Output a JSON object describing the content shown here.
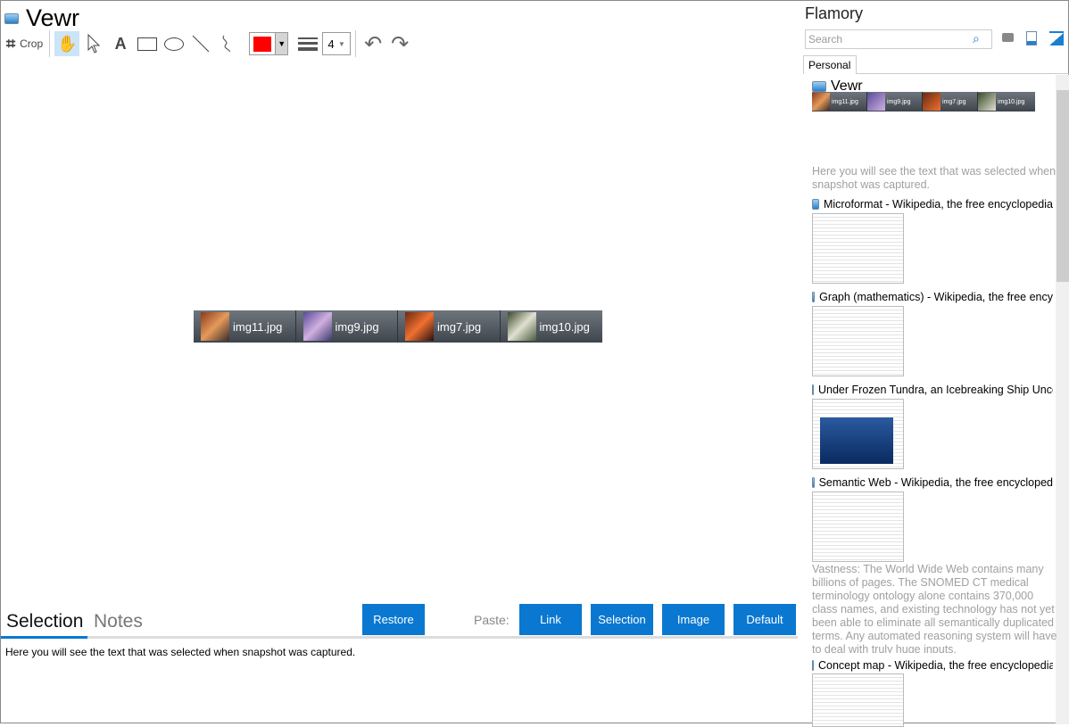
{
  "app": {
    "title": "Vewr"
  },
  "toolbar": {
    "crop": "Crop",
    "width_value": "4",
    "color": "#ff0000"
  },
  "strip": [
    {
      "name": "img11.jpg"
    },
    {
      "name": "img9.jpg"
    },
    {
      "name": "img7.jpg"
    },
    {
      "name": "img10.jpg"
    }
  ],
  "bottom": {
    "tabs": [
      "Selection",
      "Notes"
    ],
    "restore": "Restore",
    "paste_label": "Paste:",
    "paste_buttons": [
      "Link",
      "Selection",
      "Image",
      "Default"
    ],
    "selection_text": "Here you will see the text that was selected when snapshot was captured."
  },
  "sidebar": {
    "title": "Flamory",
    "search_placeholder": "Search",
    "tab": "Personal",
    "entries": [
      {
        "title": "Vewr",
        "text": "Here you will see the text that was selected when snapshot was captured."
      },
      {
        "title": "Microformat - Wikipedia, the free encyclopedia"
      },
      {
        "title": "Graph (mathematics) - Wikipedia, the free ency"
      },
      {
        "title": "Under Frozen Tundra, an Icebreaking Ship Unco"
      },
      {
        "title": "Semantic Web - Wikipedia, the free encycloped",
        "text": "Vastness: The World Wide Web contains many billions of pages. The SNOMED CT medical terminology ontology alone contains 370,000 class names, and existing technology has not yet been able to eliminate all semantically duplicated terms. Any automated reasoning system will have to deal with truly huge inputs."
      },
      {
        "title": "Concept map - Wikipedia, the free encyclopedia"
      }
    ]
  },
  "colors": {
    "accent": "#0a78d0"
  }
}
